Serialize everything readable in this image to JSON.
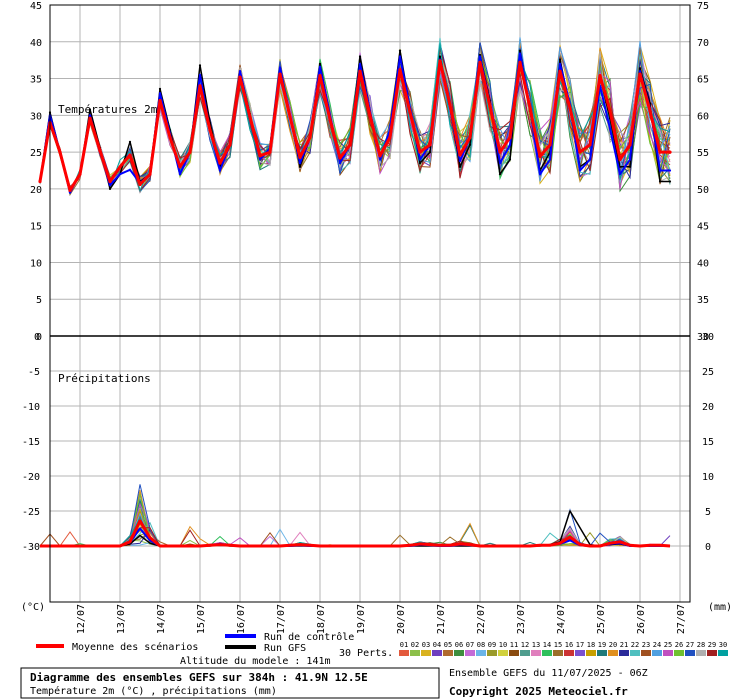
{
  "chart_data": [
    {
      "type": "line",
      "title": "Températures 2m",
      "ylabel_left": "(°C)",
      "ylim": [
        0,
        45
      ],
      "yticks_left": [
        "0",
        "5",
        "10",
        "15",
        "20",
        "25",
        "30",
        "35",
        "40",
        "45"
      ],
      "yticks_right": [
        "30",
        "35",
        "40",
        "45",
        "50",
        "55",
        "60",
        "65",
        "70",
        "75"
      ],
      "grid": true,
      "x_hours": [
        0,
        6,
        12,
        18,
        24,
        30,
        36,
        42,
        48,
        54,
        60,
        66,
        72,
        78,
        84,
        90,
        96,
        102,
        108,
        114,
        120,
        126,
        132,
        138,
        144,
        150,
        156,
        162,
        168,
        174,
        180,
        186,
        192,
        198,
        204,
        210,
        216,
        222,
        228,
        234,
        240,
        246,
        252,
        258,
        264,
        270,
        276,
        282,
        288,
        294,
        300,
        306,
        312,
        318,
        324,
        330,
        336,
        342,
        348,
        354,
        360,
        366,
        372,
        378,
        384
      ],
      "series": [
        {
          "name": "Moyenne des scénarios",
          "values": [
            21,
            29,
            25,
            19.8,
            22,
            29.6,
            25.2,
            21,
            23,
            24.6,
            20.6,
            22,
            32,
            27,
            23,
            25,
            34,
            28,
            23.5,
            26,
            35.2,
            29.8,
            24.5,
            25,
            35.6,
            29.8,
            24.3,
            27,
            35.4,
            29.4,
            24.2,
            26,
            36,
            30,
            24.5,
            27,
            36.2,
            30.4,
            25,
            26,
            37.4,
            31.4,
            24.6,
            27,
            37.2,
            31.2,
            25,
            27,
            37.2,
            31,
            24.4,
            26,
            36,
            31,
            25,
            26,
            35.4,
            30.6,
            24,
            26,
            35.6,
            30.6,
            25,
            25
          ]
        },
        {
          "name": "Run de contrôle",
          "values": [
            21,
            30,
            25,
            19.5,
            22,
            30,
            25,
            20.5,
            22,
            22.6,
            20.8,
            22,
            33,
            27.5,
            22,
            25,
            35.5,
            28,
            22.5,
            26,
            36,
            30,
            24,
            25.5,
            36.5,
            30,
            23.5,
            27,
            36.6,
            30,
            23.5,
            26,
            37,
            30.6,
            24,
            28,
            38,
            31,
            24,
            26,
            37.6,
            31,
            23.8,
            27,
            38,
            31.5,
            23.5,
            26,
            38.4,
            31,
            22,
            24,
            37,
            31.5,
            22.5,
            24,
            34,
            28.2,
            22,
            24,
            36,
            31,
            22.5,
            22.5
          ]
        },
        {
          "name": "Run GFS",
          "values": [
            21,
            30.4,
            25,
            19.6,
            22,
            30.8,
            25.6,
            20,
            22,
            26.4,
            21,
            22,
            33.6,
            28,
            22,
            25,
            36.8,
            29,
            23,
            26,
            36,
            30.2,
            24,
            25.5,
            36.4,
            30,
            23,
            27,
            37,
            30,
            23.8,
            26,
            38,
            30.6,
            24,
            28,
            38.8,
            31,
            23.5,
            25,
            38,
            31,
            23,
            26,
            38.2,
            32,
            22,
            24,
            38.8,
            30.6,
            22.5,
            25,
            37.6,
            31,
            23,
            24,
            35.2,
            29.6,
            23,
            23,
            36.4,
            31.6,
            21,
            21
          ]
        }
      ]
    },
    {
      "type": "line",
      "title": "Précipitations",
      "ylabel_right": "(mm)",
      "ylim": [
        0,
        30
      ],
      "yticks_left": [
        "-30",
        "-25",
        "-20",
        "-15",
        "-10",
        "-5",
        "0"
      ],
      "yticks_right": [
        "0",
        "5",
        "10",
        "15",
        "20",
        "25",
        "30"
      ],
      "grid": true,
      "x_hours": [
        0,
        6,
        12,
        18,
        24,
        30,
        36,
        42,
        48,
        54,
        60,
        66,
        72,
        78,
        84,
        90,
        96,
        102,
        108,
        114,
        120,
        126,
        132,
        138,
        144,
        150,
        156,
        162,
        168,
        174,
        180,
        186,
        192,
        198,
        204,
        210,
        216,
        222,
        228,
        234,
        240,
        246,
        252,
        258,
        264,
        270,
        276,
        282,
        288,
        294,
        300,
        306,
        312,
        318,
        324,
        330,
        336,
        342,
        348,
        354,
        360,
        366,
        372,
        378,
        384
      ],
      "series": [
        {
          "name": "Moyenne des scénarios",
          "values": [
            0,
            0,
            0,
            0,
            0,
            0,
            0,
            0,
            0,
            0.6,
            3.6,
            1.2,
            0,
            0,
            0,
            0,
            0,
            0.1,
            0.2,
            0.1,
            0,
            0,
            0,
            0,
            0,
            0.1,
            0.2,
            0.1,
            0,
            0,
            0,
            0,
            0,
            0,
            0,
            0,
            0,
            0.1,
            0.3,
            0.2,
            0.1,
            0.1,
            0.3,
            0.2,
            0,
            0,
            0,
            0,
            0,
            0,
            0.1,
            0.1,
            0.4,
            1.3,
            0.2,
            0,
            0,
            0.4,
            0.6,
            0.1,
            0,
            0.1,
            0.1,
            0
          ]
        },
        {
          "name": "Run de contrôle",
          "values": [
            0,
            0,
            0,
            0,
            0,
            0,
            0,
            0,
            0,
            0.5,
            2.5,
            0.8,
            0,
            0,
            0,
            0,
            0,
            0.1,
            0.3,
            0.1,
            0,
            0,
            0,
            0,
            0,
            0,
            0.1,
            0,
            0,
            0,
            0,
            0,
            0,
            0,
            0,
            0,
            0,
            0,
            0.2,
            0.1,
            0,
            0,
            0.2,
            0.1,
            0,
            0,
            0,
            0,
            0,
            0,
            0.1,
            0.1,
            0.3,
            0.8,
            0.1,
            0,
            0,
            0.3,
            0.4,
            0,
            0,
            0,
            0,
            0
          ]
        },
        {
          "name": "Run GFS",
          "values": [
            0,
            0,
            0,
            0,
            0,
            0,
            0,
            0,
            0,
            0.3,
            1.5,
            0.4,
            0,
            0,
            0,
            0,
            0,
            0,
            0.2,
            0,
            0,
            0,
            0,
            0,
            0,
            0,
            0,
            0,
            0,
            0,
            0,
            0,
            0,
            0,
            0,
            0,
            0,
            0,
            0,
            0,
            0,
            0,
            0,
            0,
            0,
            0,
            0,
            0,
            0,
            0,
            0,
            0.2,
            0.6,
            5,
            2.6,
            0.2,
            0,
            0.2,
            0.3,
            0,
            0,
            0,
            0,
            0
          ]
        }
      ]
    }
  ],
  "x_date_labels": [
    "12/07",
    "13/07",
    "14/07",
    "15/07",
    "16/07",
    "17/07",
    "18/07",
    "19/07",
    "20/07",
    "21/07",
    "22/07",
    "23/07",
    "24/07",
    "25/07",
    "26/07",
    "27/07"
  ],
  "ens_numbers": [
    "01",
    "02",
    "03",
    "04",
    "05",
    "06",
    "07",
    "08",
    "09",
    "10",
    "11",
    "12",
    "13",
    "14",
    "15",
    "16",
    "17",
    "18",
    "19",
    "20",
    "21",
    "22",
    "23",
    "24",
    "25",
    "26",
    "27",
    "28",
    "29",
    "30"
  ],
  "ens_colors": [
    "#e3593c",
    "#8cbf4a",
    "#d9b21f",
    "#6f3fbf",
    "#b06a2e",
    "#3e8e3e",
    "#c46bd6",
    "#6bb5e8",
    "#9a9a2a",
    "#d1d13d",
    "#8a4b0f",
    "#4f9d8e",
    "#e07fbd",
    "#2fbf5c",
    "#9b6f2a",
    "#cc3333",
    "#7a50d0",
    "#c8a000",
    "#1f7a7a",
    "#e09020",
    "#2a2a9a",
    "#4fbfbf",
    "#a05020",
    "#50a0e0",
    "#c050c0",
    "#70c030",
    "#2050c0",
    "#b0b0b0",
    "#a02020",
    "#00a0a0"
  ],
  "colors": {
    "mean": "#ff0000",
    "control": "#0000ff",
    "gfs": "#000000",
    "grid": "#b4b4b4"
  },
  "legend": {
    "mean_label": "Moyenne des scénarios",
    "control_label": "Run de contrôle",
    "gfs_label": "Run GFS",
    "perts_label": "30 Perts.",
    "altitude_label": "Altitude du modele : 141m"
  },
  "footer": {
    "title": "Diagramme des ensembles GEFS sur 384h : 41.9N 12.5E",
    "subtitle": "Température 2m (°C) , précipitations (mm)",
    "ensemble_run": "Ensemble GEFS du 11/07/2025 - 06Z",
    "copyright": "Copyright 2025 Meteociel.fr"
  }
}
